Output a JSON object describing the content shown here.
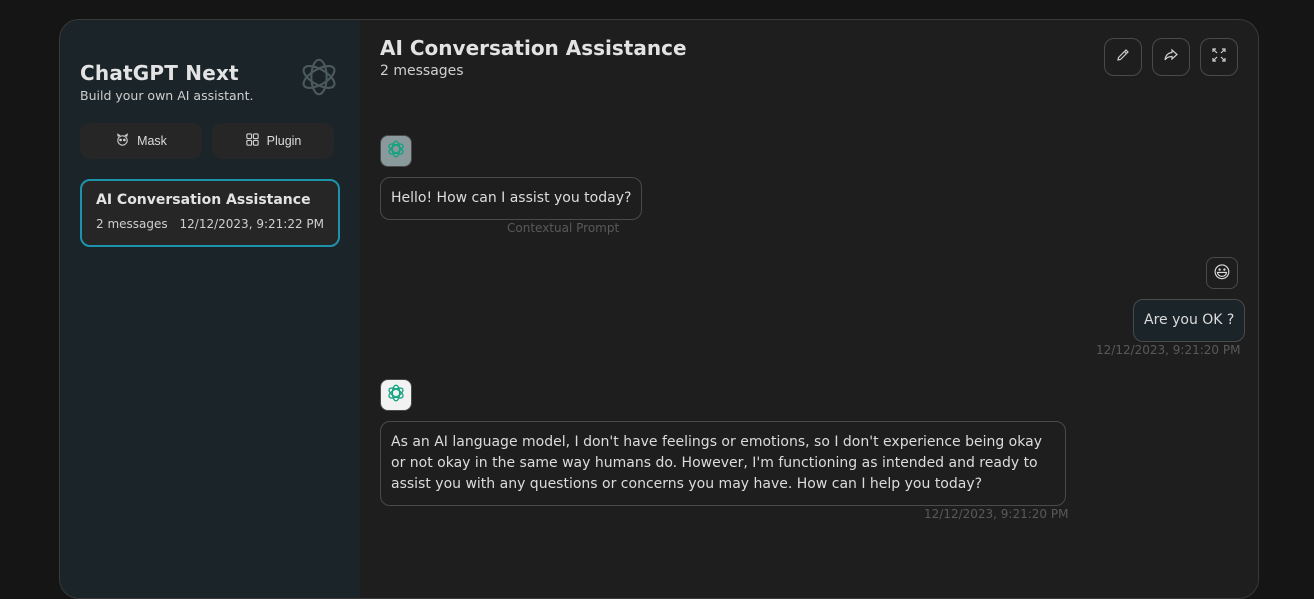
{
  "sidebar": {
    "title": "ChatGPT Next",
    "subtitle": "Build your own AI assistant.",
    "mask_label": "Mask",
    "plugin_label": "Plugin",
    "chats": [
      {
        "title": "AI Conversation Assistance",
        "count": "2 messages",
        "time": "12/12/2023, 9:21:22 PM"
      }
    ]
  },
  "header": {
    "title": "AI Conversation Assistance",
    "subtitle": "2 messages",
    "actions": [
      "edit-icon",
      "share-icon",
      "fullscreen-icon"
    ]
  },
  "messages": [
    {
      "role": "assistant",
      "text": "Hello! How can I assist you today?",
      "meta": "Contextual Prompt"
    },
    {
      "role": "user",
      "avatar": "😃",
      "text": "Are you OK ?",
      "meta": "12/12/2023, 9:21:20 PM"
    },
    {
      "role": "assistant",
      "text": "As an AI language model, I don't have feelings or emotions, so I don't experience being okay or not okay in the same way humans do. However, I'm functioning as intended and ready to assist you with any questions or concerns you may have. How can I help you today?",
      "meta": "12/12/2023, 9:21:20 PM"
    }
  ],
  "colors": {
    "accent": "#1d93ab",
    "sidebar_bg": "#1b2428",
    "main_bg": "#1e1e1e",
    "openai_teal": "#10a37f"
  }
}
